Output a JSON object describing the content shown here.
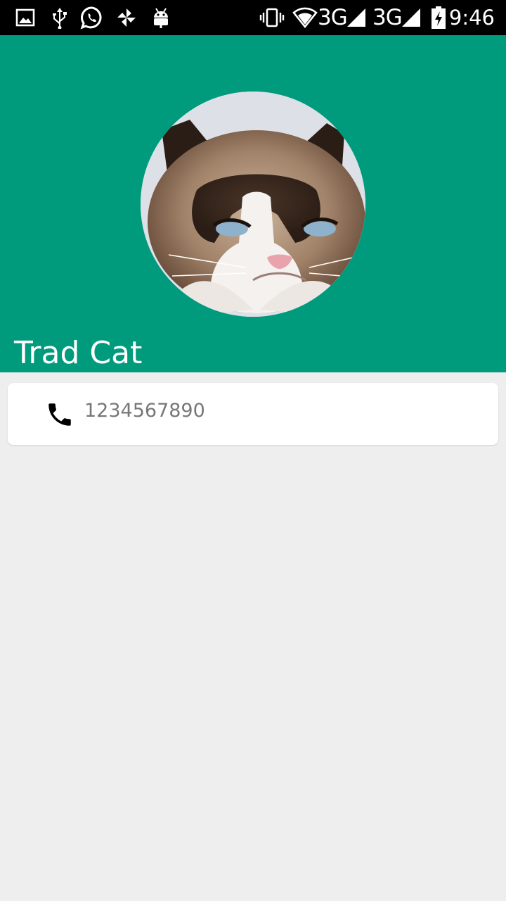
{
  "status_bar": {
    "network_1": "3G",
    "network_2": "3G",
    "time": "9:46",
    "left_icons": [
      "gallery-icon",
      "usb-icon",
      "whatsapp-icon",
      "pinwheel-icon",
      "android-icon"
    ],
    "right_icons": [
      "vibrate-icon",
      "wifi-icon",
      "signal-icon",
      "signal-icon",
      "battery-charging-icon"
    ]
  },
  "contact": {
    "name": "Trad Cat",
    "phone": "1234567890",
    "phone_icon": "phone-icon"
  },
  "colors": {
    "header_bg": "#009b7d",
    "page_bg": "#eeeeee",
    "card_bg": "#ffffff",
    "phone_text": "#777777"
  }
}
